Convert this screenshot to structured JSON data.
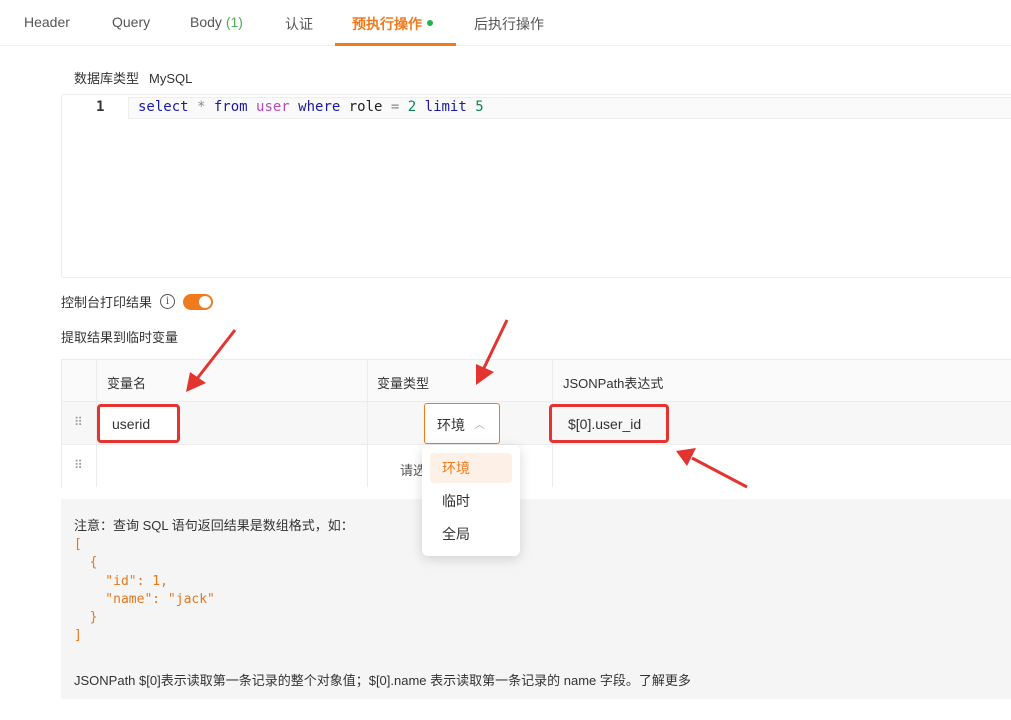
{
  "tabs": [
    {
      "label": "Header"
    },
    {
      "label": "Query"
    },
    {
      "label": "Body",
      "count": "(1)"
    },
    {
      "label": "认证"
    },
    {
      "label": "预执行操作",
      "active": true
    },
    {
      "label": "后执行操作"
    }
  ],
  "db": {
    "label": "数据库类型",
    "value": "MySQL"
  },
  "editor": {
    "line_number": "1",
    "tokens": {
      "t1": "select",
      "t2": " * ",
      "t3": "from",
      "t4": " user ",
      "t5": "where",
      "t6": " role ",
      "t7": "=",
      "t8": " 2 ",
      "t9": "limit",
      "t10": " 5"
    }
  },
  "console": {
    "label": "控制台打印结果",
    "info_icon": "i",
    "enabled": true
  },
  "extract": {
    "label": "提取结果到临时变量"
  },
  "table": {
    "headers": {
      "name": "变量名",
      "type": "变量类型",
      "path": "JSONPath表达式"
    },
    "drag_icon": "⠿",
    "row1": {
      "name": "userid",
      "type": "环境",
      "path": "$[0].user_id"
    },
    "row2": {
      "type_placeholder": "请选"
    }
  },
  "dropdown": {
    "options": [
      "环境",
      "临时",
      "全局"
    ],
    "selected": "环境"
  },
  "note": {
    "title": "注意：查询 SQL 语句返回结果是数组格式，如：",
    "code": "[\n  {\n    \"id\": 1,\n    \"name\": \"jack\"\n  }\n]",
    "footer": "JSONPath $[0]表示读取第一条记录的整个对象值；$[0].name 表示读取第一条记录的 name 字段。",
    "more_link": "了解更多"
  },
  "colors": {
    "accent": "#f07b1f",
    "annotation": "#e3342f",
    "status_dot": "#22b14c"
  }
}
